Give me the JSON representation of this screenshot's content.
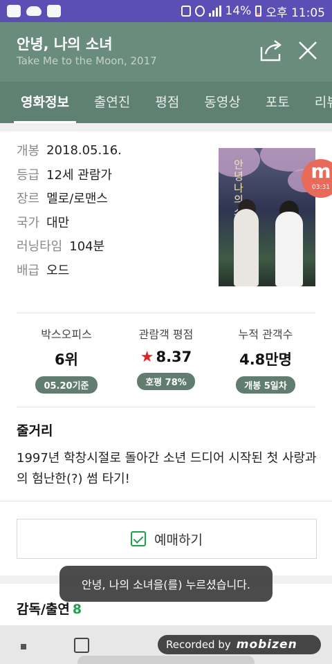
{
  "status_bar": {
    "battery": "14%",
    "time": "오후 11:05"
  },
  "header": {
    "title": "안녕, 나의 소녀",
    "subtitle": "Take Me to the Moon, 2017",
    "icons": [
      "share-icon",
      "close-icon"
    ]
  },
  "tabs": [
    {
      "label": "영화정보",
      "active": true
    },
    {
      "label": "출연진"
    },
    {
      "label": "평점"
    },
    {
      "label": "동영상"
    },
    {
      "label": "포토"
    },
    {
      "label": "리뷰"
    }
  ],
  "info": [
    {
      "key": "개봉",
      "value": "2018.05.16."
    },
    {
      "key": "등급",
      "value": "12세 관람가"
    },
    {
      "key": "장르",
      "value": "멜로/로맨스"
    },
    {
      "key": "국가",
      "value": "대만"
    },
    {
      "key": "러닝타임",
      "value": "104분"
    },
    {
      "key": "배급",
      "value": "오드"
    }
  ],
  "poster": {
    "title_text": "안녕 나의 소녀"
  },
  "overlay_badge": {
    "letter": "m",
    "timer": "03:31"
  },
  "stats": [
    {
      "label": "박스오피스",
      "value": "6위",
      "chip": "05.20기준"
    },
    {
      "label": "관람객 평점",
      "value": "8.37",
      "chip": "호평 78%"
    },
    {
      "label": "누적 관객수",
      "value": "4.8만명",
      "chip": "개봉 5일차"
    }
  ],
  "synopsis": {
    "title": "줄거리",
    "text": "1997년 학창시절로 돌아간 소년 드디어 시작된 첫 사랑과의 험난한(?) 썸 타기!"
  },
  "booking": {
    "label": "예매하기"
  },
  "cast": {
    "title": "감독/출연",
    "count": "8"
  },
  "toast": {
    "message": "안녕, 나의 소녀을(를) 누르셨습니다."
  },
  "recording": {
    "prefix": "Recorded by",
    "brand": "mobizen"
  },
  "colors": {
    "status_bar": "#5b4fb5",
    "header": "#6a8c7e",
    "tabs": "#5f8173",
    "accent_green": "#1aa34a",
    "rating_star": "#e02424"
  }
}
